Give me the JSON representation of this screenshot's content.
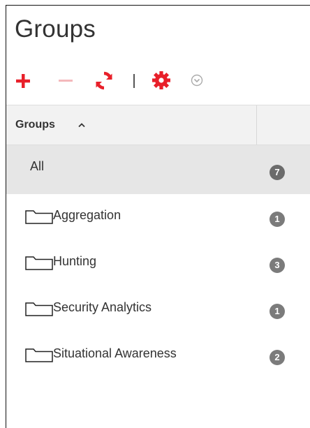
{
  "header": {
    "title": "Groups"
  },
  "toolbar": {
    "add_icon": "plus-icon",
    "remove_icon": "minus-icon",
    "refresh_icon": "refresh-icon",
    "settings_icon": "gear-icon",
    "settings_dropdown_icon": "chevron-down-circle-icon",
    "colors": {
      "add": "#e8202a",
      "remove_disabled": "#f4b8bb",
      "refresh": "#e8202a",
      "gear": "#e8202a",
      "caret": "#aaaaaa"
    }
  },
  "grid": {
    "column_header": "Groups",
    "sort": "ascending",
    "rows": [
      {
        "label": "All",
        "count": "7",
        "selected": true,
        "folder": false
      },
      {
        "label": "Aggregation",
        "count": "1",
        "selected": false,
        "folder": true
      },
      {
        "label": "Hunting",
        "count": "3",
        "selected": false,
        "folder": true
      },
      {
        "label": "Security Analytics",
        "count": "1",
        "selected": false,
        "folder": true
      },
      {
        "label": "Situational Awareness",
        "count": "2",
        "selected": false,
        "folder": true
      }
    ]
  }
}
